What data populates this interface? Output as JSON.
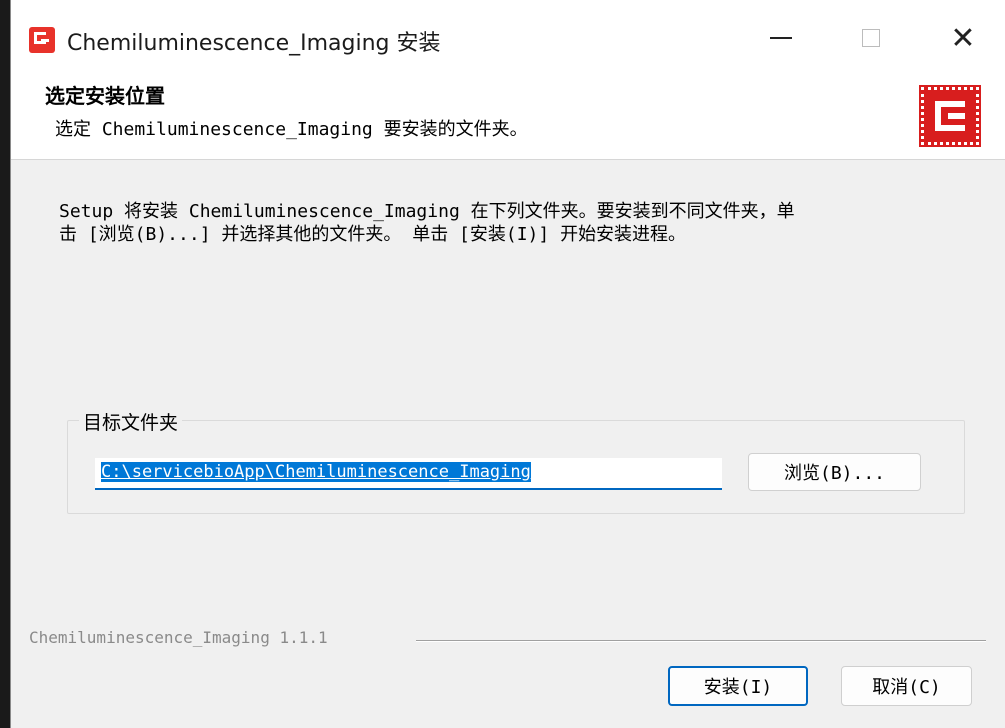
{
  "window": {
    "title": "Chemiluminescence_Imaging 安装",
    "controls": {
      "minimize": "—",
      "maximize": "□",
      "close": "✕"
    }
  },
  "header": {
    "title": "选定安装位置",
    "subtitle": "选定 Chemiluminescence_Imaging 要安装的文件夹。"
  },
  "body": {
    "description_line1": "Setup 将安装 Chemiluminescence_Imaging 在下列文件夹。要安装到不同文件夹，单",
    "description_line2": "击 [浏览(B)...] 并选择其他的文件夹。 单击 [安装(I)] 开始安装进程。"
  },
  "destination": {
    "group_label": "目标文件夹",
    "path_value": "C:\\servicebioApp\\Chemiluminescence_Imaging",
    "browse_label": "浏览(B)..."
  },
  "footer": {
    "version_text": "Chemiluminescence_Imaging 1.1.1",
    "install_label": "安装(I)",
    "cancel_label": "取消(C)"
  },
  "colors": {
    "accent": "#0067c0",
    "selection": "#0078d7",
    "brand_red": "#d81e1e",
    "window_bg": "#f0f0f0"
  },
  "icons": [
    "app-logo-icon",
    "minimize-icon",
    "maximize-icon",
    "close-icon",
    "brand-logo-icon"
  ]
}
